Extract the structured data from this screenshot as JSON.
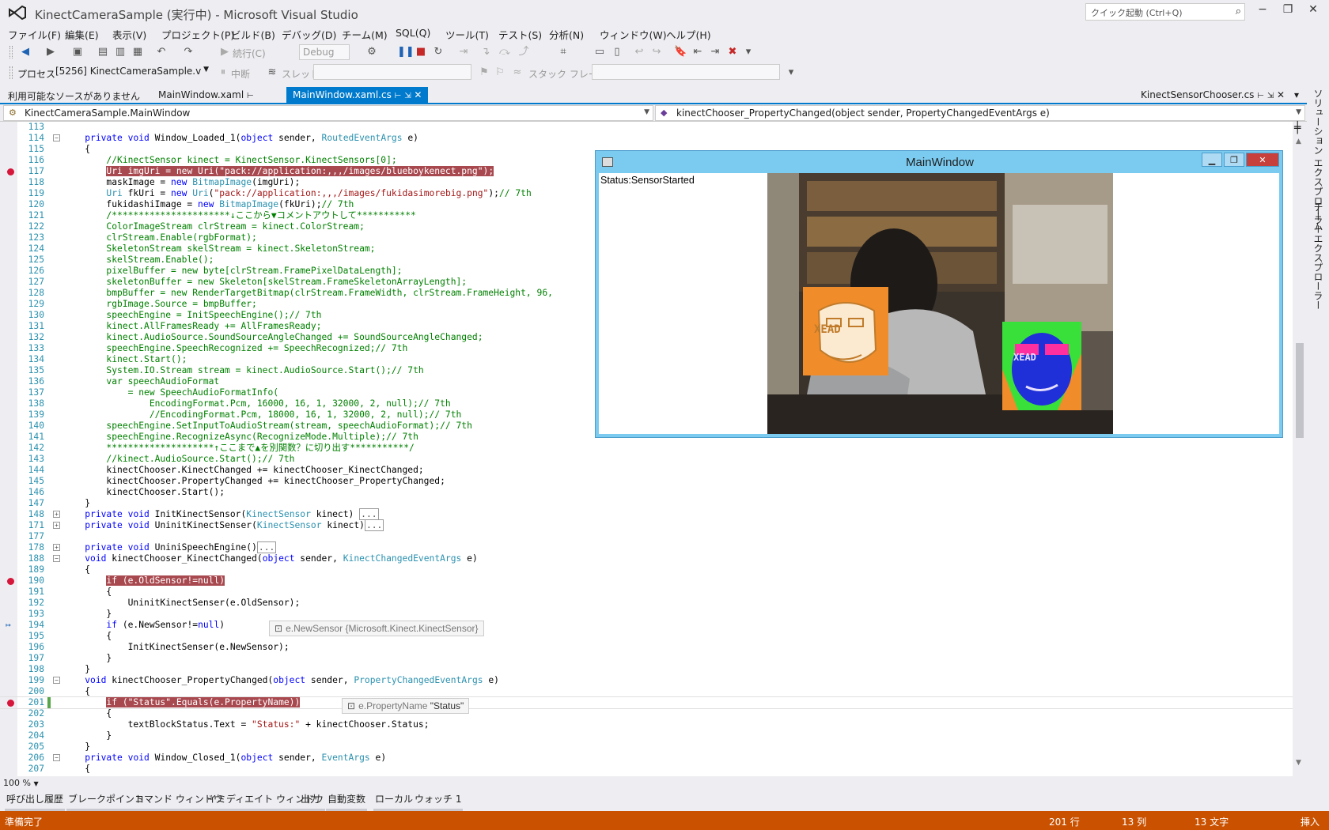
{
  "window": {
    "title": "KinectCameraSample (実行中) - Microsoft Visual Studio",
    "quick_launch_placeholder": "クイック起動 (Ctrl+Q)"
  },
  "menu": [
    "ファイル(F)",
    "編集(E)",
    "表示(V)",
    "プロジェクト(P)",
    "ビルド(B)",
    "デバッグ(D)",
    "チーム(M)",
    "SQL(Q)",
    "ツール(T)",
    "テスト(S)",
    "分析(N)",
    "ウィンドウ(W)",
    "ヘルプ(H)"
  ],
  "toolbar": {
    "continue_label": "続行(C)",
    "config_value": "Debug",
    "process_label": "プロセス",
    "process_value": "[5256] KinectCameraSample.v",
    "suspend_label": "中断",
    "thread_label": "スレッド",
    "stackframe_label": "スタック フレーム"
  },
  "tabs": {
    "no_source": "利用可能なソースがありません",
    "tab1": "MainWindow.xaml",
    "tab2": "MainWindow.xaml.cs",
    "tab3": "KinectSensorChooser.cs"
  },
  "navbar": {
    "class_combo": "KinectCameraSample.MainWindow",
    "member_combo": "kinectChooser_PropertyChanged(object sender, PropertyChangedEventArgs e)"
  },
  "code_lines": [
    {
      "n": "113",
      "html": ""
    },
    {
      "n": "114",
      "fold": "−",
      "html": "    <span class=\"kw\">private</span> <span class=\"kw\">void</span> Window_Loaded_1(<span class=\"kw\">object</span> sender, <span class=\"typ\">RoutedEventArgs</span> e)"
    },
    {
      "n": "115",
      "html": "    {"
    },
    {
      "n": "116",
      "html": "        <span class=\"cmt\">//KinectSensor kinect = KinectSensor.KinectSensors[0];</span>"
    },
    {
      "n": "117",
      "bp": true,
      "html": "        <span class=\"hl-bp\">Uri imgUri = new Uri(\"pack://application:,,,/images/blueboykenect.png\");</span>"
    },
    {
      "n": "118",
      "html": "        maskImage = <span class=\"kw\">new</span> <span class=\"typ\">BitmapImage</span>(imgUri);"
    },
    {
      "n": "119",
      "html": "        <span class=\"typ\">Uri</span> fkUri = <span class=\"kw\">new</span> <span class=\"typ\">Uri</span>(<span class=\"str\">\"pack://application:,,,/images/fukidasimorebig.png\"</span>);<span class=\"cmt\">// 7th</span>"
    },
    {
      "n": "120",
      "html": "        fukidashiImage = <span class=\"kw\">new</span> <span class=\"typ\">BitmapImage</span>(fkUri);<span class=\"cmt\">// 7th</span>"
    },
    {
      "n": "121",
      "html": "        <span class=\"cmt\">/**********************↓ここから▼コメントアウトして***********</span>"
    },
    {
      "n": "122",
      "html": "<span class=\"cmt\">        ColorImageStream clrStream = kinect.ColorStream;</span>"
    },
    {
      "n": "123",
      "html": "<span class=\"cmt\">        clrStream.Enable(rgbFormat);</span>"
    },
    {
      "n": "124",
      "html": "<span class=\"cmt\">        SkeletonStream skelStream = kinect.SkeletonStream;</span>"
    },
    {
      "n": "125",
      "html": "<span class=\"cmt\">        skelStream.Enable();</span>"
    },
    {
      "n": "126",
      "html": "<span class=\"cmt\">        pixelBuffer = new byte[clrStream.FramePixelDataLength];</span>"
    },
    {
      "n": "127",
      "html": "<span class=\"cmt\">        skeletonBuffer = new Skeleton[skelStream.FrameSkeletonArrayLength];</span>"
    },
    {
      "n": "128",
      "html": "<span class=\"cmt\">        bmpBuffer = new RenderTargetBitmap(clrStream.FrameWidth, clrStream.FrameHeight, 96,</span>"
    },
    {
      "n": "129",
      "html": "<span class=\"cmt\">        rgbImage.Source = bmpBuffer;</span>"
    },
    {
      "n": "130",
      "html": "<span class=\"cmt\">        speechEngine = InitSpeechEngine();// 7th</span>"
    },
    {
      "n": "131",
      "html": "<span class=\"cmt\">        kinect.AllFramesReady += AllFramesReady;</span>"
    },
    {
      "n": "132",
      "html": "<span class=\"cmt\">        kinect.AudioSource.SoundSourceAngleChanged += SoundSourceAngleChanged;</span>"
    },
    {
      "n": "133",
      "html": "<span class=\"cmt\">        speechEngine.SpeechRecognized += SpeechRecognized;// 7th</span>"
    },
    {
      "n": "134",
      "html": "<span class=\"cmt\">        kinect.Start();</span>"
    },
    {
      "n": "135",
      "html": "<span class=\"cmt\">        System.IO.Stream stream = kinect.AudioSource.Start();// 7th</span>"
    },
    {
      "n": "136",
      "html": "<span class=\"cmt\">        var speechAudioFormat</span>"
    },
    {
      "n": "137",
      "html": "<span class=\"cmt\">            = new SpeechAudioFormatInfo(</span>"
    },
    {
      "n": "138",
      "html": "<span class=\"cmt\">                EncodingFormat.Pcm, 16000, 16, 1, 32000, 2, null);// 7th</span>"
    },
    {
      "n": "139",
      "html": "<span class=\"cmt\">                //EncodingFormat.Pcm, 18000, 16, 1, 32000, 2, null);// 7th</span>"
    },
    {
      "n": "140",
      "html": "<span class=\"cmt\">        speechEngine.SetInputToAudioStream(stream, speechAudioFormat);// 7th</span>"
    },
    {
      "n": "141",
      "html": "<span class=\"cmt\">        speechEngine.RecognizeAsync(RecognizeMode.Multiple);// 7th</span>"
    },
    {
      "n": "142",
      "html": "<span class=\"cmt\">        ********************↑ここまで▲を別関数？に切り出す***********/</span>"
    },
    {
      "n": "143",
      "html": "        <span class=\"cmt\">//kinect.AudioSource.Start();// 7th</span>"
    },
    {
      "n": "144",
      "html": "        kinectChooser.KinectChanged += kinectChooser_KinectChanged;"
    },
    {
      "n": "145",
      "html": "        kinectChooser.PropertyChanged += kinectChooser_PropertyChanged;"
    },
    {
      "n": "146",
      "html": "        kinectChooser.Start();"
    },
    {
      "n": "147",
      "html": "    }"
    },
    {
      "n": "148",
      "fold": "+",
      "html": "    <span class=\"kw\">private</span> <span class=\"kw\">void</span> InitKinectSensor(<span class=\"typ\">KinectSensor</span> kinect) <span class=\"collapsed\">...</span>"
    },
    {
      "n": "171",
      "fold": "+",
      "html": "    <span class=\"kw\">private</span> <span class=\"kw\">void</span> UninitKinectSenser(<span class=\"typ\">KinectSensor</span> kinect)<span class=\"collapsed\">...</span>"
    },
    {
      "n": "177",
      "html": ""
    },
    {
      "n": "178",
      "fold": "+",
      "html": "    <span class=\"kw\">private</span> <span class=\"kw\">void</span> UniniSpeechEngine()<span class=\"collapsed\">...</span>"
    },
    {
      "n": "188",
      "fold": "−",
      "html": "    <span class=\"kw\">void</span> kinectChooser_KinectChanged(<span class=\"kw\">object</span> sender, <span class=\"typ\">KinectChangedEventArgs</span> e)"
    },
    {
      "n": "189",
      "html": "    {"
    },
    {
      "n": "190",
      "bp": true,
      "html": "        <span class=\"hl-bp\">if (e.OldSensor!=null)</span>"
    },
    {
      "n": "191",
      "html": "        {"
    },
    {
      "n": "192",
      "html": "            UninitKinectSenser(e.OldSensor);"
    },
    {
      "n": "193",
      "html": "        }"
    },
    {
      "n": "194",
      "mark": "↦",
      "html": "        <span class=\"kw\">if</span> (e.NewSensor!=<span class=\"kw\">null</span>)"
    },
    {
      "n": "195",
      "html": "        {"
    },
    {
      "n": "196",
      "html": "            InitKinectSenser(e.NewSensor);"
    },
    {
      "n": "197",
      "html": "        }"
    },
    {
      "n": "198",
      "html": "    }"
    },
    {
      "n": "199",
      "fold": "−",
      "html": "    <span class=\"kw\">void</span> kinectChooser_PropertyChanged(<span class=\"kw\">object</span> sender, <span class=\"typ\">PropertyChangedEventArgs</span> e)"
    },
    {
      "n": "200",
      "html": "    {"
    },
    {
      "n": "201",
      "bp": true,
      "changed": true,
      "html": "        <span class=\"hl-bp\">if (\"Status\".Equals(e.PropertyName))</span>"
    },
    {
      "n": "202",
      "html": "        {"
    },
    {
      "n": "203",
      "html": "            textBlockStatus.Text = <span class=\"str\">\"Status:\"</span> + kinectChooser.Status;"
    },
    {
      "n": "204",
      "html": "        }"
    },
    {
      "n": "205",
      "html": "    }"
    },
    {
      "n": "206",
      "fold": "−",
      "html": "    <span class=\"kw\">private</span> <span class=\"kw\">void</span> Window_Closed_1(<span class=\"kw\">object</span> sender, <span class=\"typ\">EventArgs</span> e)"
    },
    {
      "n": "207",
      "html": "    {"
    }
  ],
  "datatips": {
    "newsensor_name": "e.NewSensor",
    "newsensor_value": "{Microsoft.Kinect.KinectSensor}",
    "propname_name": "e.PropertyName",
    "propname_value": "\"Status\""
  },
  "zoom": "100 %",
  "side_panel": {
    "solution_explorer": "ソリューション エクスプローラー",
    "team_explorer": "チーム エクスプローラー"
  },
  "bottom_tabs": [
    "呼び出し履歴",
    "ブレークポイント",
    "コマンド ウィンドウ",
    "イミディエイト ウィンドウ",
    "出力",
    "自動変数",
    "ローカル",
    "ウォッチ 1"
  ],
  "statusbar": {
    "ready": "準備完了",
    "line": "201 行",
    "col": "13 列",
    "ch": "13 文字",
    "mode": "挿入"
  },
  "app_window": {
    "title": "MainWindow",
    "status_text": "Status:SensorStarted",
    "mask_text": "XEAD"
  },
  "colors": {
    "accent": "#007acc",
    "statusbar_debug": "#ca5100",
    "breakpoint": "#d6163a",
    "app_titlebar": "#7bcbf0"
  }
}
